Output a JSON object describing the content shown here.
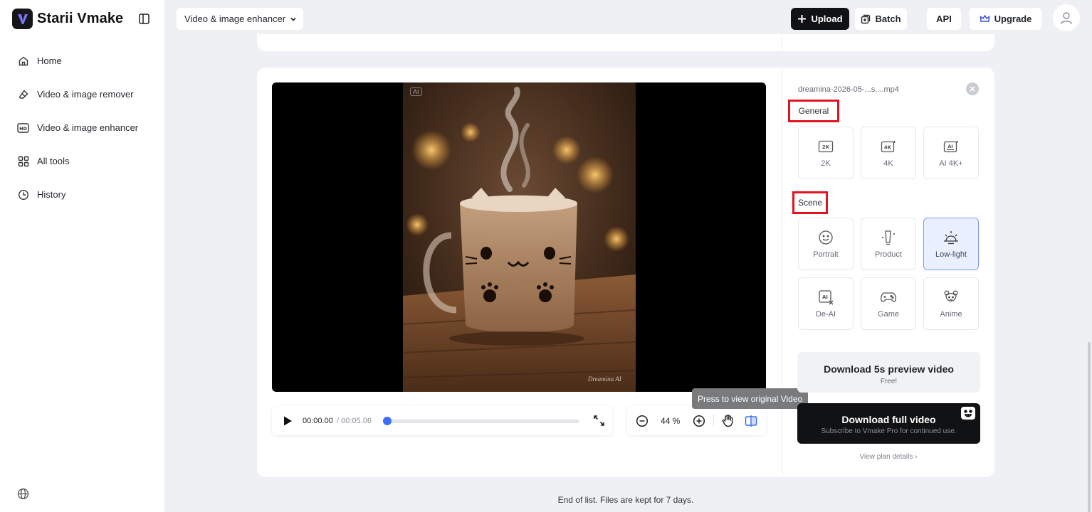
{
  "app": {
    "name": "Starii Vmake"
  },
  "sidebar": {
    "items": [
      {
        "label": "Home",
        "icon": "home-icon"
      },
      {
        "label": "Video & image remover",
        "icon": "eraser-icon"
      },
      {
        "label": "Video & image enhancer",
        "icon": "hd-icon"
      },
      {
        "label": "All tools",
        "icon": "grid-icon"
      },
      {
        "label": "History",
        "icon": "clock-icon"
      }
    ]
  },
  "header": {
    "mode_label": "Video & image enhancer",
    "upload_label": "Upload",
    "batch_label": "Batch",
    "api_label": "API",
    "upgrade_label": "Upgrade"
  },
  "video": {
    "watermark_top": "AI",
    "watermark_bottom": "Dreamina AI"
  },
  "player": {
    "current_time": "00:00.00",
    "total_time": "/ 00:05.06",
    "progress": 0.0
  },
  "zoom": {
    "value": "44 %"
  },
  "tooltip": {
    "text": "Press to view original Video"
  },
  "panel": {
    "file_name": "dreamina-2026-05-...s....mp4",
    "general_label": "General",
    "general_options": [
      "2K",
      "4K",
      "AI 4K+"
    ],
    "scene_label": "Scene",
    "scene_options": [
      "Portrait",
      "Product",
      "Low-light",
      "De-AI",
      "Game",
      "Anime"
    ],
    "selected_scene": "Low-light",
    "download_preview": {
      "title": "Download 5s preview video",
      "subtitle": "Free!"
    },
    "download_full": {
      "title": "Download full video",
      "subtitle": "Subscribe to Vmake Pro for continued use."
    },
    "plan_link": "View plan details"
  },
  "footer": {
    "note": "End of list. Files are kept for 7 days."
  },
  "colors": {
    "accent": "#3b6ff5",
    "highlight_box": "#e3141f",
    "selected_bg": "#eaf0ff"
  }
}
